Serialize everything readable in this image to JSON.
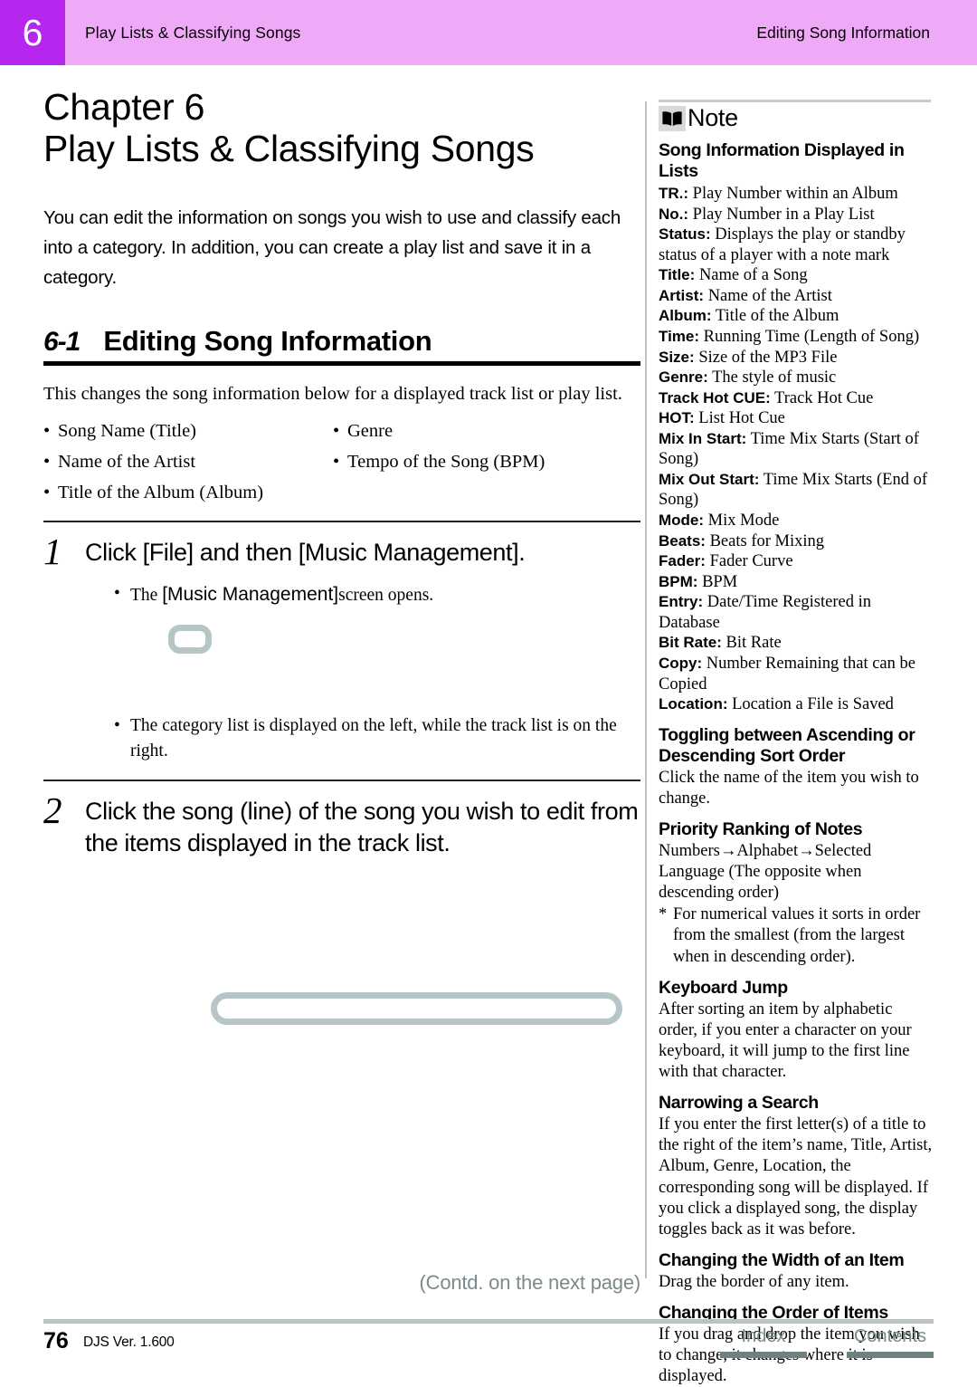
{
  "header": {
    "chapter_badge": "6",
    "left_title": "Play Lists & Classifying Songs",
    "right_title": "Editing Song Information",
    "badge_color": "#b626ee",
    "bar_color": "#eeaaf7"
  },
  "main": {
    "chapter_label": "Chapter 6",
    "chapter_title": "Play Lists & Classifying Songs",
    "intro": "You can edit the information on songs you wish to use and classify each into a category. In addition, you can create a play list and save it in a category.",
    "section_number": "6-1",
    "section_title": "Editing Song Information",
    "lead": "This changes the song information below for a displayed track list or play list.",
    "bullets": [
      "Song Name (Title)",
      "Genre",
      "Name of the Artist",
      "Tempo of the Song (BPM)",
      "Title of the Album (Album)",
      ""
    ],
    "steps": [
      {
        "number": "1",
        "text": "Click [File] and then [Music Management].",
        "sub_pre": "The ",
        "sub_ui": "[Music Management]",
        "sub_post": "screen opens.",
        "note_bullet": "The category list is displayed on the left, while the track list is on the right."
      },
      {
        "number": "2",
        "text": "Click the song (line) of the song you wish to edit from the items displayed in the track list."
      }
    ],
    "contd": "(Contd. on the next page)"
  },
  "note": {
    "icon_name": "open-book-icon",
    "label": "Note",
    "sections": [
      {
        "heading": "Song Information Displayed in Lists",
        "entries": [
          {
            "term": "TR.:",
            "desc": " Play Number within an Album"
          },
          {
            "term": "No.:",
            "desc": " Play Number in a Play List"
          },
          {
            "term": "Status:",
            "desc": " Displays the play or standby status of a player with a note mark"
          },
          {
            "term": "Title:",
            "desc": " Name of a Song"
          },
          {
            "term": "Artist:",
            "desc": " Name of the Artist"
          },
          {
            "term": "Album:",
            "desc": " Title of the Album"
          },
          {
            "term": "Time:",
            "desc": " Running Time (Length of Song)"
          },
          {
            "term": "Size:",
            "desc": " Size of the MP3 File"
          },
          {
            "term": "Genre:",
            "desc": " The style of music"
          },
          {
            "term": "Track Hot CUE:",
            "desc": " Track Hot Cue"
          },
          {
            "term": "HOT:",
            "desc": " List Hot Cue"
          },
          {
            "term": "Mix In Start:",
            "desc": " Time Mix Starts (Start of Song)"
          },
          {
            "term": "Mix Out Start:",
            "desc": " Time Mix Starts (End of Song)"
          },
          {
            "term": "Mode:",
            "desc": " Mix Mode"
          },
          {
            "term": "Beats:",
            "desc": " Beats for Mixing"
          },
          {
            "term": "Fader:",
            "desc": " Fader Curve"
          },
          {
            "term": "BPM:",
            "desc": " BPM"
          },
          {
            "term": "Entry:",
            "desc": " Date/Time Registered in Database"
          },
          {
            "term": "Bit Rate:",
            "desc": " Bit Rate"
          },
          {
            "term": "Copy:",
            "desc": " Number Remaining that can be Copied"
          },
          {
            "term": "Location:",
            "desc": " Location a File is Saved"
          }
        ]
      },
      {
        "heading": "Toggling between Ascending or Descending Sort Order",
        "body": "Click the name of the item you wish to change."
      },
      {
        "heading": "Priority Ranking of Notes",
        "body": "Numbers→Alphabet→Selected Language (The opposite when descending order)",
        "star": "For numerical values it sorts in order from the smallest (from the largest when in descending order)."
      },
      {
        "heading": "Keyboard Jump",
        "body": "After sorting an item by alphabetic order, if you enter a character on your keyboard, it will jump to the first line with that character."
      },
      {
        "heading": "Narrowing a Search",
        "body": "If you enter the first letter(s) of a title to the right of the item’s name, Title, Artist, Album, Genre, Location, the corresponding song will be displayed. If you click a displayed song, the display toggles back as it was before."
      },
      {
        "heading": "Changing the Width of an Item",
        "body": "Drag the border of any item."
      },
      {
        "heading": "Changing the Order of Items",
        "body": "If you drag and drop the item you wish to change, it changes where it is displayed."
      }
    ]
  },
  "footer": {
    "page_number": "76",
    "version": "DJS Ver. 1.600",
    "links": [
      {
        "label": "Index"
      },
      {
        "label": "Contents"
      }
    ],
    "link_color": "#7b8a8a",
    "bar_color": "#6d8181"
  }
}
